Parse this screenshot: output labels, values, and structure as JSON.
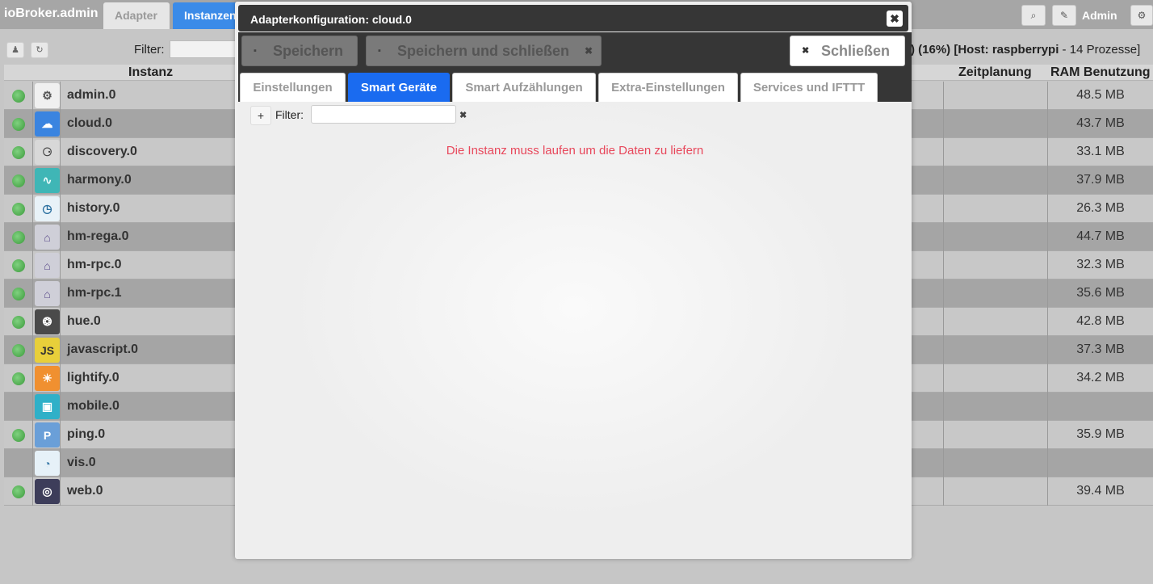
{
  "topbar": {
    "app_title": "ioBroker.admin",
    "tabs": [
      "Adapter",
      "Instanzen"
    ],
    "search_icon": "⌕",
    "edit_icon": "✎",
    "user": "Admin",
    "settings_icon": "⚙"
  },
  "page": {
    "filter_label": "Filter:",
    "status_prefix": ") (16%) [Host: ",
    "status_host": "raspberrypi",
    "status_suffix": " - 14 Prozesse]",
    "columns": {
      "instanz": "Instanz",
      "zeitplanung": "Zeitplanung",
      "ram": "RAM Benutzung"
    },
    "instances": [
      {
        "name": "admin.0",
        "icon": "gear-icon",
        "running": true,
        "ram": "48.5 MB"
      },
      {
        "name": "cloud.0",
        "icon": "cloud-icon",
        "running": true,
        "ram": "43.7 MB"
      },
      {
        "name": "discovery.0",
        "icon": "binoculars-icon",
        "running": true,
        "ram": "33.1 MB"
      },
      {
        "name": "harmony.0",
        "icon": "harmony-icon",
        "running": true,
        "ram": "37.9 MB"
      },
      {
        "name": "history.0",
        "icon": "clock-icon",
        "running": true,
        "ram": "26.3 MB"
      },
      {
        "name": "hm-rega.0",
        "icon": "homematic-icon",
        "running": true,
        "ram": "44.7 MB"
      },
      {
        "name": "hm-rpc.0",
        "icon": "homematic-icon",
        "running": true,
        "ram": "32.3 MB"
      },
      {
        "name": "hm-rpc.1",
        "icon": "homematic-icon",
        "running": true,
        "ram": "35.6 MB"
      },
      {
        "name": "hue.0",
        "icon": "hue-icon",
        "running": true,
        "ram": "42.8 MB"
      },
      {
        "name": "javascript.0",
        "icon": "js-icon",
        "running": true,
        "ram": "37.3 MB"
      },
      {
        "name": "lightify.0",
        "icon": "osram-icon",
        "running": true,
        "ram": "34.2 MB"
      },
      {
        "name": "mobile.0",
        "icon": "mobile-icon",
        "running": false,
        "ram": ""
      },
      {
        "name": "ping.0",
        "icon": "ping-icon",
        "running": true,
        "ram": "35.9 MB"
      },
      {
        "name": "vis.0",
        "icon": "gauge-icon",
        "running": false,
        "ram": ""
      },
      {
        "name": "web.0",
        "icon": "globe-icon",
        "running": true,
        "ram": "39.4 MB"
      }
    ]
  },
  "modal": {
    "title": "Adapterkonfiguration: cloud.0",
    "close_icon": "✖",
    "save_label": "Speichern",
    "save_close_label": "Speichern und schließen",
    "close_label": "Schließen",
    "save_icon": "▪",
    "x_icon": "✖",
    "tabs": [
      "Einstellungen",
      "Smart Geräte",
      "Smart Aufzählungen",
      "Extra-Einstellungen",
      "Services und IFTTT"
    ],
    "active_tab": 1,
    "add_icon": "+",
    "filter_label": "Filter:",
    "filter_value": "",
    "clear_icon": "✖",
    "message": "Die Instanz muss laufen um die Daten zu liefern"
  }
}
